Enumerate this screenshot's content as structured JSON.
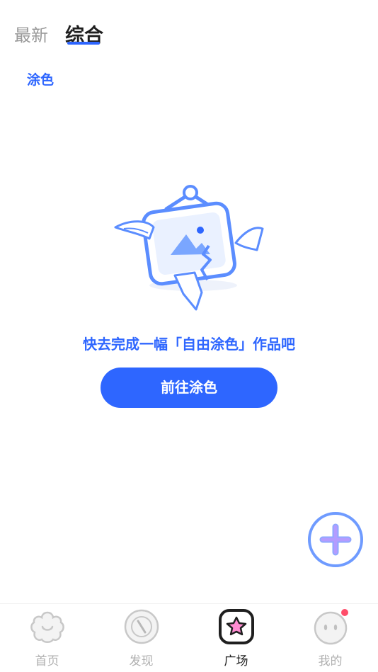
{
  "top_tabs": {
    "latest": "最新",
    "all": "综合",
    "active": "综合"
  },
  "filter": {
    "label": "涂色"
  },
  "empty_state": {
    "message": "快去完成一幅「自由涂色」作品吧",
    "button_label": "前往涂色"
  },
  "fab": {
    "icon": "plus-icon"
  },
  "bottom_nav": {
    "items": [
      {
        "label": "首页",
        "icon": "flower-face-icon",
        "active": false
      },
      {
        "label": "发现",
        "icon": "compass-icon",
        "active": false
      },
      {
        "label": "广场",
        "icon": "star-badge-icon",
        "active": true
      },
      {
        "label": "我的",
        "icon": "face-icon",
        "active": false,
        "has_dot": true
      }
    ]
  },
  "colors": {
    "accent": "#2e66ff",
    "inactive": "#b0b0b0",
    "badge_dot": "#ff4d6a",
    "star_pink": "#ff8cd2"
  }
}
